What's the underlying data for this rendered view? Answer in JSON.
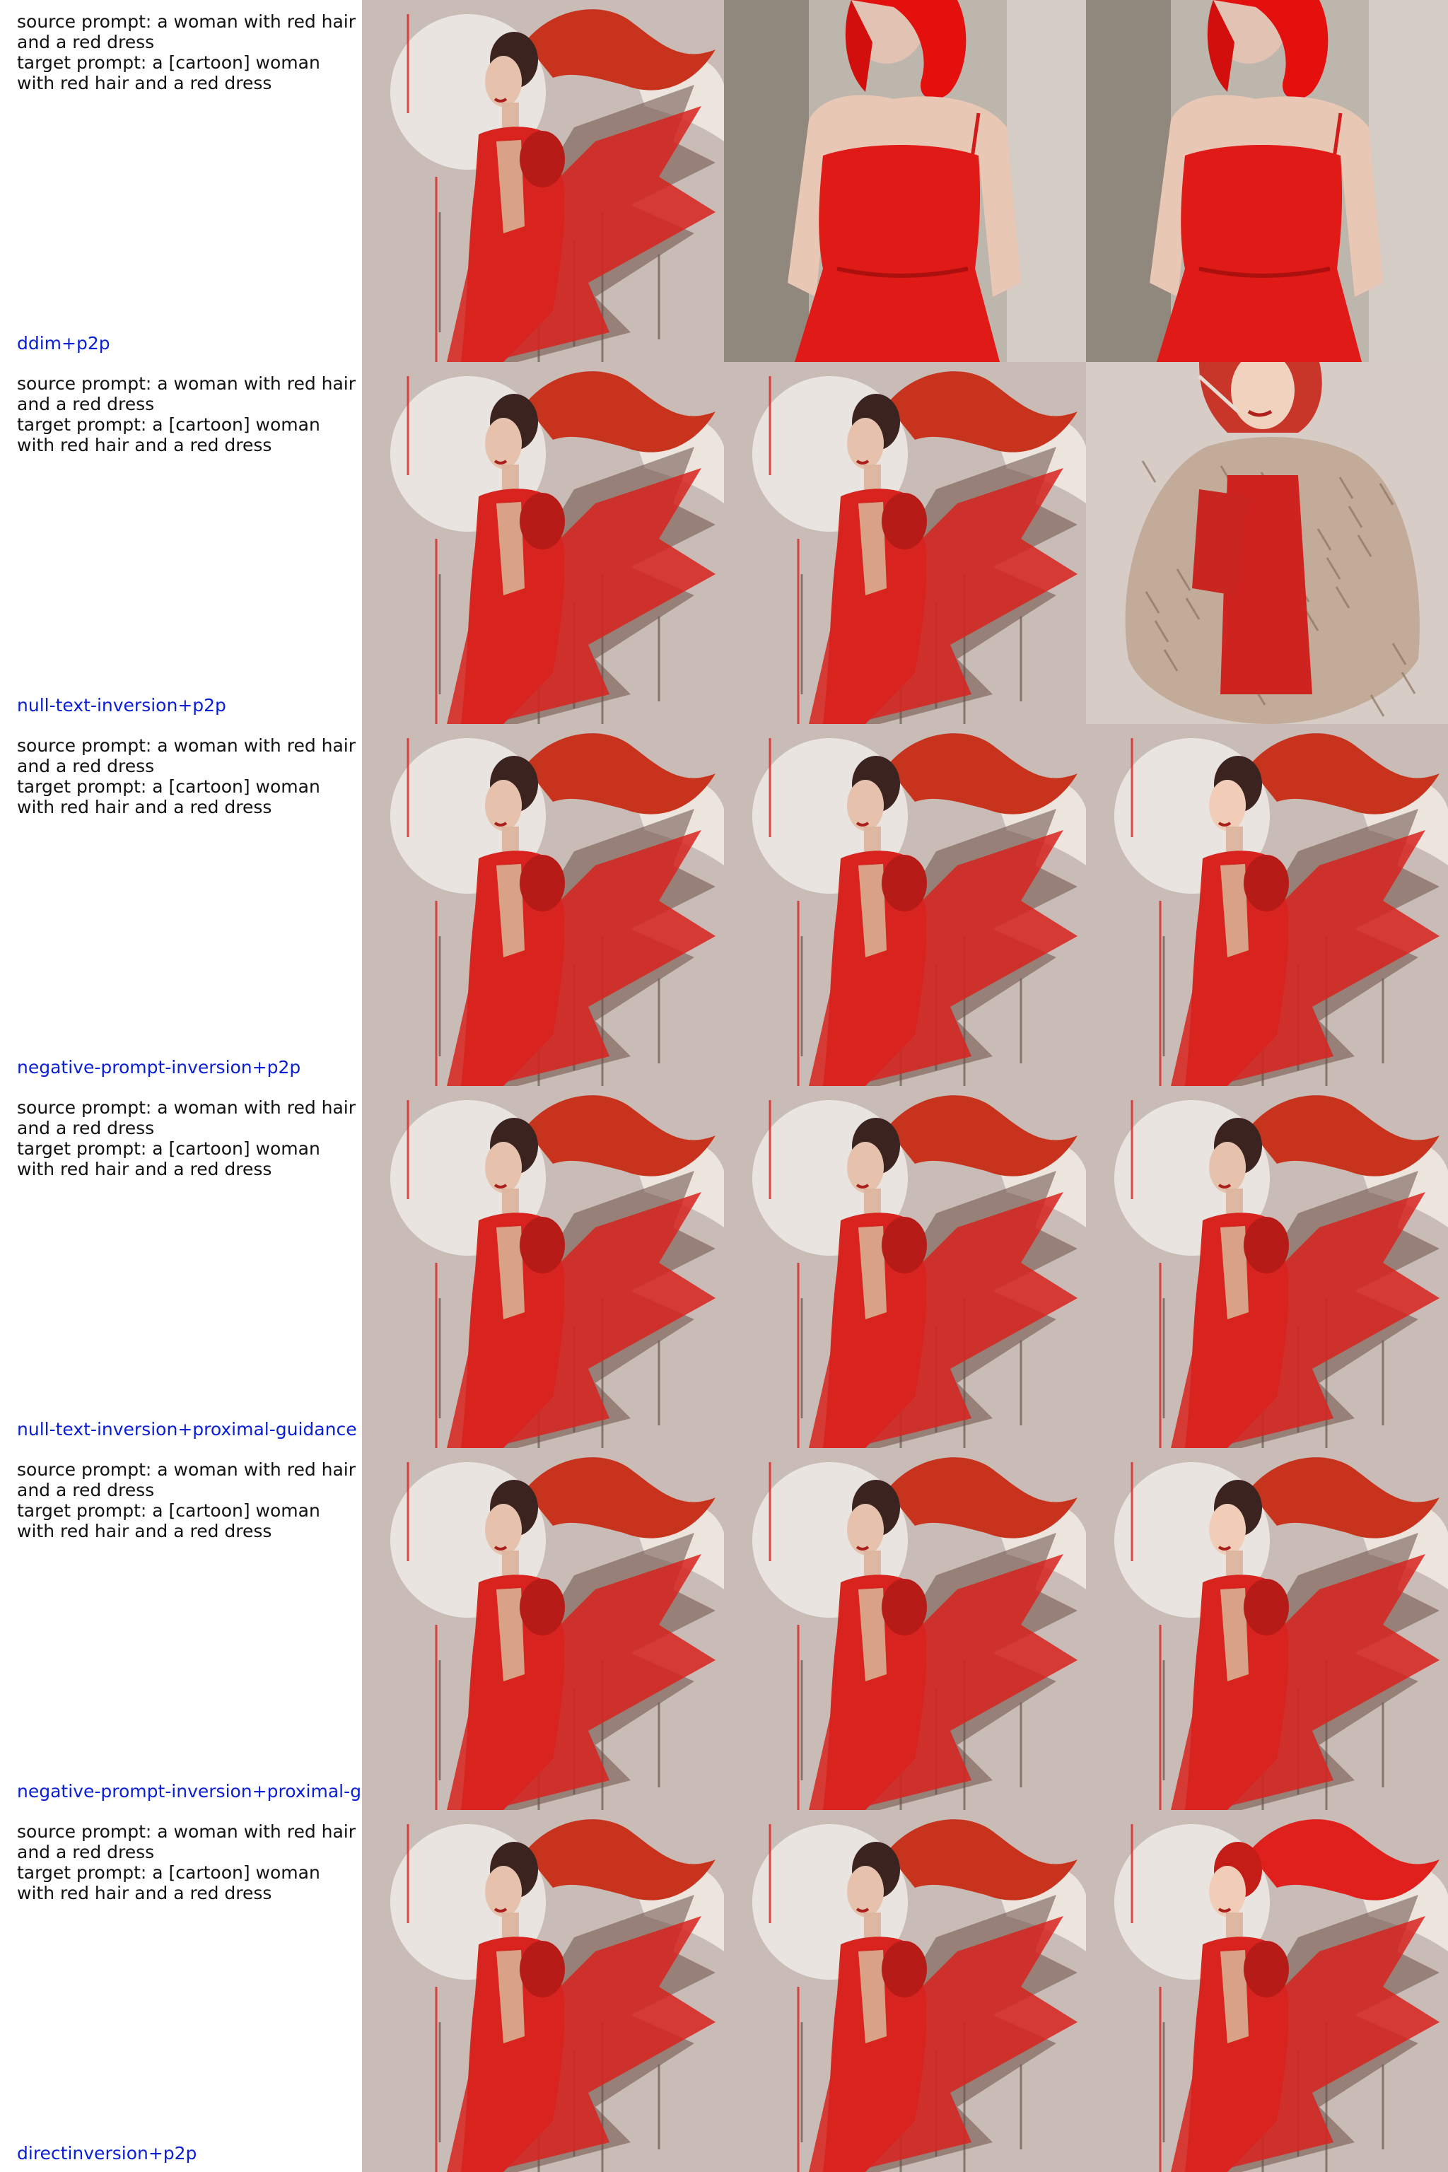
{
  "rows": [
    {
      "prompt_lines": [
        "source prompt: a woman with red hair",
        "and a red dress",
        "target prompt: a [cartoon] woman",
        "with red hair and a red dress"
      ],
      "method": "ddim+p2p",
      "images": [
        "painted-woman-red-hair-ponytail",
        "photo-woman-red-hair-red-dress",
        "photo-woman-red-hair-red-dress"
      ]
    },
    {
      "prompt_lines": [
        "source prompt: a woman with red hair",
        "and a red dress",
        "target prompt: a [cartoon] woman",
        "with red hair and a red dress"
      ],
      "method": "null-text-inversion+p2p",
      "images": [
        "painted-woman-red-hair-ponytail",
        "painted-woman-red-hair-ponytail",
        "illustrated-woman-fur-coat-red-dress"
      ]
    },
    {
      "prompt_lines": [
        "source prompt: a woman with red hair",
        "and a red dress",
        "target prompt: a [cartoon] woman",
        "with red hair and a red dress"
      ],
      "method": "negative-prompt-inversion+p2p",
      "images": [
        "painted-woman-red-hair-ponytail",
        "painted-woman-red-hair-ponytail",
        "cartoon-woman-red-hair-ponytail"
      ]
    },
    {
      "prompt_lines": [
        "source prompt: a woman with red hair",
        "and a red dress",
        "target prompt: a [cartoon] woman",
        "with red hair and a red dress"
      ],
      "method": "null-text-inversion+proximal-guidance",
      "images": [
        "painted-woman-red-hair-ponytail",
        "painted-woman-red-hair-ponytail",
        "painted-woman-red-hair-ponytail"
      ]
    },
    {
      "prompt_lines": [
        "source prompt: a woman with red hair",
        "and a red dress",
        "target prompt: a [cartoon] woman",
        "with red hair and a red dress"
      ],
      "method": "negative-prompt-inversion+proximal-g",
      "images": [
        "painted-woman-red-hair-ponytail",
        "painted-woman-red-hair-ponytail",
        "cartoon-woman-red-hair-ponytail"
      ]
    },
    {
      "prompt_lines": [
        "source prompt: a woman with red hair",
        "and a red dress",
        "target prompt: a [cartoon] woman",
        "with red hair and a red dress"
      ],
      "method": "directinversion+p2p",
      "images": [
        "painted-woman-red-hair-ponytail",
        "painted-woman-red-hair-ponytail",
        "cartoon-woman-red-hair-red-dress"
      ]
    }
  ],
  "colors": {
    "method_label": "#0a1ed6",
    "prompt_text": "#111111",
    "painting_background": "#c9bcb6",
    "dress_red": "#d8231f",
    "hair_red": "#c8331e"
  }
}
